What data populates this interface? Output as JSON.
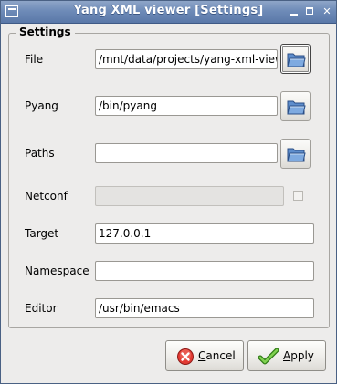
{
  "window": {
    "title": "Yang XML viewer [Settings]",
    "minimize_icon": "minimize-icon",
    "maximize_icon": "maximize-icon",
    "close_glyph": "✕"
  },
  "settings": {
    "group_title": "Settings",
    "file": {
      "label": "File",
      "value": "/mnt/data/projects/yang-xml-viewer/"
    },
    "pyang": {
      "label": "Pyang",
      "value": "/bin/pyang"
    },
    "paths": {
      "label": "Paths",
      "value": ""
    },
    "netconf": {
      "label": "Netconf",
      "value": "",
      "checked": false
    },
    "target": {
      "label": "Target",
      "value": "127.0.0.1"
    },
    "namespace": {
      "label": "Namespace",
      "value": ""
    },
    "editor": {
      "label": "Editor",
      "value": "/usr/bin/emacs"
    }
  },
  "buttons": {
    "cancel_mnemonic": "C",
    "cancel_rest": "ancel",
    "apply_mnemonic": "A",
    "apply_rest": "pply"
  },
  "icons": {
    "browse": "folder-icon",
    "cancel": "cancel-icon",
    "apply": "checkmark-icon"
  },
  "colors": {
    "titlebar": "#6e8bb8",
    "cancel_red": "#d8322e",
    "apply_green": "#4caf2a",
    "folder_blue": "#4f7fc0"
  }
}
